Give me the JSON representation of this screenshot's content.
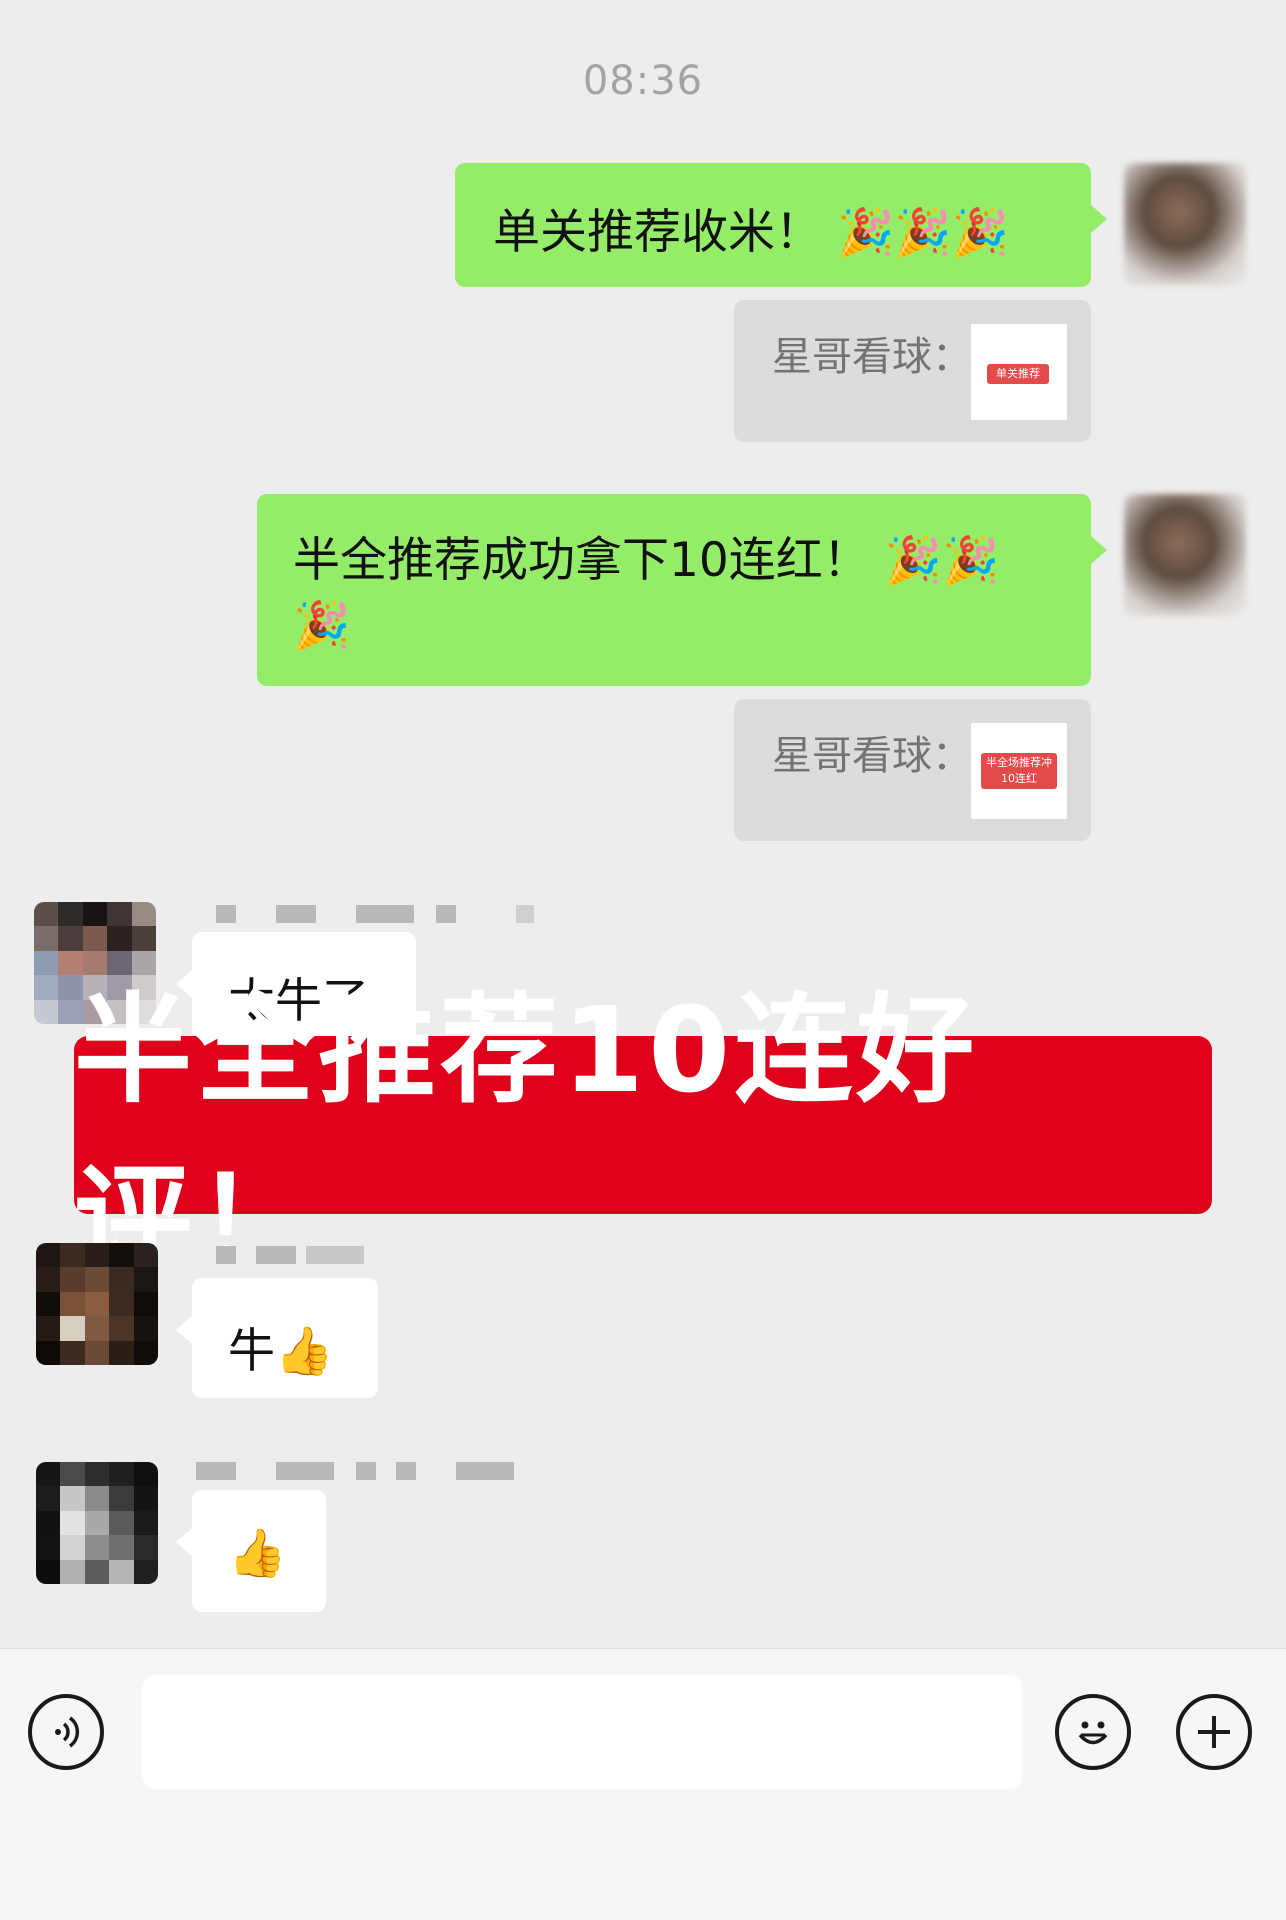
{
  "chat": {
    "timestamp": "08:36",
    "messages": [
      {
        "text": "单关推荐收米！",
        "emoji": "🎉🎉🎉"
      },
      {
        "quote_author": "星哥看球：",
        "thumb_badge": "单关推荐"
      },
      {
        "line1": "半全推荐成功拿下10连红！",
        "line1_emoji": "🎉🎉",
        "line2_emoji": "🎉"
      },
      {
        "quote_author": "星哥看球：",
        "thumb_badge": "半全场推荐冲10连红"
      },
      {
        "text": "太牛了"
      },
      {
        "text": "牛",
        "emoji": "👍"
      },
      {
        "emoji": "👍"
      }
    ]
  },
  "banner": {
    "text": "半全推荐10连好评！"
  },
  "input_bar": {
    "voice_icon": "voice-icon",
    "emoji_icon": "emoji-icon",
    "plus_icon": "plus-icon"
  },
  "colors": {
    "background": "#ededed",
    "self_bubble": "#95ec69",
    "other_bubble": "#ffffff",
    "banner_red": "#e0001b"
  }
}
